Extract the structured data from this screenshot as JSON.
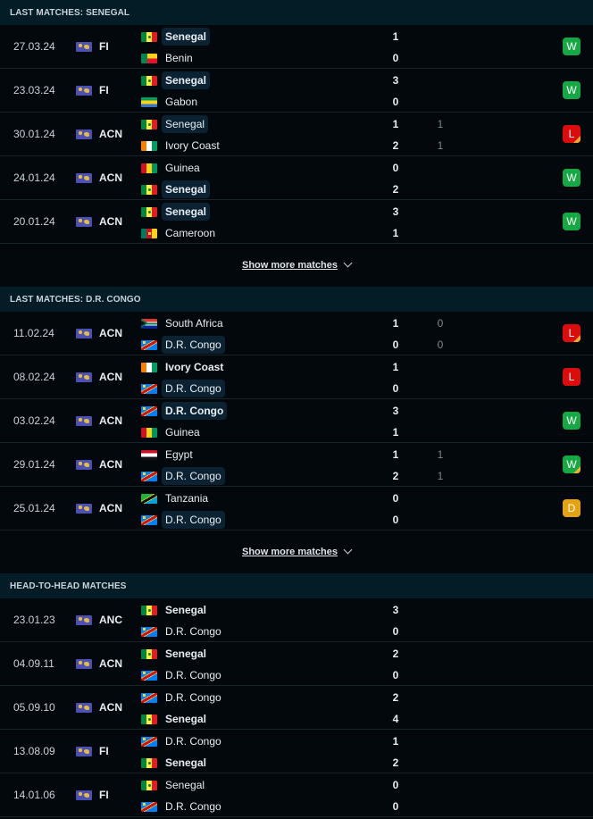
{
  "sections": [
    {
      "title": "LAST MATCHES: SENEGAL",
      "show_more": "Show more matches",
      "matches": [
        {
          "date": "27.03.24",
          "competition": "FI",
          "competition_icon": "world-icon",
          "home": {
            "name": "Senegal",
            "flag": "senegal",
            "highlight": true,
            "bold": true,
            "score": "1",
            "sub": ""
          },
          "away": {
            "name": "Benin",
            "flag": "benin",
            "highlight": false,
            "bold": false,
            "score": "0",
            "sub": ""
          },
          "result": "W",
          "penalties": false
        },
        {
          "date": "23.03.24",
          "competition": "FI",
          "competition_icon": "world-icon",
          "home": {
            "name": "Senegal",
            "flag": "senegal",
            "highlight": true,
            "bold": true,
            "score": "3",
            "sub": ""
          },
          "away": {
            "name": "Gabon",
            "flag": "gabon",
            "highlight": false,
            "bold": false,
            "score": "0",
            "sub": ""
          },
          "result": "W",
          "penalties": false
        },
        {
          "date": "30.01.24",
          "competition": "ACN",
          "competition_icon": "world-icon",
          "home": {
            "name": "Senegal",
            "flag": "senegal",
            "highlight": true,
            "bold": false,
            "score": "1",
            "sub": "1"
          },
          "away": {
            "name": "Ivory Coast",
            "flag": "ivory",
            "highlight": false,
            "bold": false,
            "score": "2",
            "sub": "1"
          },
          "result": "L",
          "penalties": true
        },
        {
          "date": "24.01.24",
          "competition": "ACN",
          "competition_icon": "world-icon",
          "home": {
            "name": "Guinea",
            "flag": "guinea",
            "highlight": false,
            "bold": false,
            "score": "0",
            "sub": ""
          },
          "away": {
            "name": "Senegal",
            "flag": "senegal",
            "highlight": true,
            "bold": true,
            "score": "2",
            "sub": ""
          },
          "result": "W",
          "penalties": false
        },
        {
          "date": "20.01.24",
          "competition": "ACN",
          "competition_icon": "world-icon",
          "home": {
            "name": "Senegal",
            "flag": "senegal",
            "highlight": true,
            "bold": true,
            "score": "3",
            "sub": ""
          },
          "away": {
            "name": "Cameroon",
            "flag": "cameroon",
            "highlight": false,
            "bold": false,
            "score": "1",
            "sub": ""
          },
          "result": "W",
          "penalties": false
        }
      ]
    },
    {
      "title": "LAST MATCHES: D.R. CONGO",
      "show_more": "Show more matches",
      "matches": [
        {
          "date": "11.02.24",
          "competition": "ACN",
          "competition_icon": "world-icon",
          "home": {
            "name": "South Africa",
            "flag": "southafrica",
            "highlight": false,
            "bold": false,
            "score": "1",
            "sub": "0"
          },
          "away": {
            "name": "D.R. Congo",
            "flag": "drc",
            "highlight": true,
            "bold": false,
            "score": "0",
            "sub": "0"
          },
          "result": "L",
          "penalties": true
        },
        {
          "date": "08.02.24",
          "competition": "ACN",
          "competition_icon": "world-icon",
          "home": {
            "name": "Ivory Coast",
            "flag": "ivory",
            "highlight": false,
            "bold": true,
            "score": "1",
            "sub": ""
          },
          "away": {
            "name": "D.R. Congo",
            "flag": "drc",
            "highlight": true,
            "bold": false,
            "score": "0",
            "sub": ""
          },
          "result": "L",
          "penalties": false
        },
        {
          "date": "03.02.24",
          "competition": "ACN",
          "competition_icon": "world-icon",
          "home": {
            "name": "D.R. Congo",
            "flag": "drc",
            "highlight": true,
            "bold": true,
            "score": "3",
            "sub": ""
          },
          "away": {
            "name": "Guinea",
            "flag": "guinea",
            "highlight": false,
            "bold": false,
            "score": "1",
            "sub": ""
          },
          "result": "W",
          "penalties": false
        },
        {
          "date": "29.01.24",
          "competition": "ACN",
          "competition_icon": "world-icon",
          "home": {
            "name": "Egypt",
            "flag": "egypt",
            "highlight": false,
            "bold": false,
            "score": "1",
            "sub": "1"
          },
          "away": {
            "name": "D.R. Congo",
            "flag": "drc",
            "highlight": true,
            "bold": false,
            "score": "2",
            "sub": "1"
          },
          "result": "W",
          "penalties": true
        },
        {
          "date": "25.01.24",
          "competition": "ACN",
          "competition_icon": "world-icon",
          "home": {
            "name": "Tanzania",
            "flag": "tanzania",
            "highlight": false,
            "bold": false,
            "score": "0",
            "sub": ""
          },
          "away": {
            "name": "D.R. Congo",
            "flag": "drc",
            "highlight": true,
            "bold": false,
            "score": "0",
            "sub": ""
          },
          "result": "D",
          "penalties": false
        }
      ]
    },
    {
      "title": "HEAD-TO-HEAD MATCHES",
      "show_more": "",
      "matches": [
        {
          "date": "23.01.23",
          "competition": "ANC",
          "competition_icon": "world-icon",
          "home": {
            "name": "Senegal",
            "flag": "senegal",
            "highlight": false,
            "bold": true,
            "score": "3",
            "sub": ""
          },
          "away": {
            "name": "D.R. Congo",
            "flag": "drc",
            "highlight": false,
            "bold": false,
            "score": "0",
            "sub": ""
          },
          "result": "",
          "penalties": false
        },
        {
          "date": "04.09.11",
          "competition": "ACN",
          "competition_icon": "world-icon",
          "home": {
            "name": "Senegal",
            "flag": "senegal",
            "highlight": false,
            "bold": true,
            "score": "2",
            "sub": ""
          },
          "away": {
            "name": "D.R. Congo",
            "flag": "drc",
            "highlight": false,
            "bold": false,
            "score": "0",
            "sub": ""
          },
          "result": "",
          "penalties": false
        },
        {
          "date": "05.09.10",
          "competition": "ACN",
          "competition_icon": "world-icon",
          "home": {
            "name": "D.R. Congo",
            "flag": "drc",
            "highlight": false,
            "bold": false,
            "score": "2",
            "sub": ""
          },
          "away": {
            "name": "Senegal",
            "flag": "senegal",
            "highlight": false,
            "bold": true,
            "score": "4",
            "sub": ""
          },
          "result": "",
          "penalties": false
        },
        {
          "date": "13.08.09",
          "competition": "FI",
          "competition_icon": "world-icon",
          "home": {
            "name": "D.R. Congo",
            "flag": "drc",
            "highlight": false,
            "bold": false,
            "score": "1",
            "sub": ""
          },
          "away": {
            "name": "Senegal",
            "flag": "senegal",
            "highlight": false,
            "bold": true,
            "score": "2",
            "sub": ""
          },
          "result": "",
          "penalties": false
        },
        {
          "date": "14.01.06",
          "competition": "FI",
          "competition_icon": "world-icon",
          "home": {
            "name": "Senegal",
            "flag": "senegal",
            "highlight": false,
            "bold": false,
            "score": "0",
            "sub": ""
          },
          "away": {
            "name": "D.R. Congo",
            "flag": "drc",
            "highlight": false,
            "bold": false,
            "score": "0",
            "sub": ""
          },
          "result": "",
          "penalties": false
        }
      ]
    }
  ],
  "colors": {
    "win": "#16a844",
    "loss": "#dc0c0c",
    "draw": "#e5a312",
    "header_bg": "#031c25",
    "page_bg": "#02080c"
  }
}
